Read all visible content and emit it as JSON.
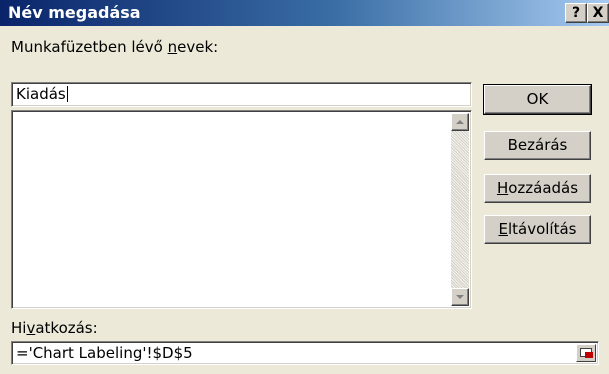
{
  "dialog": {
    "title": "Név megadása",
    "help_glyph": "?",
    "close_glyph": "X"
  },
  "names": {
    "label_pre": "Munkafüzetben lévő ",
    "label_u": "n",
    "label_post": "evek:",
    "value": "Kiadás",
    "list_items": []
  },
  "buttons": {
    "ok": "OK",
    "close": "Bezárás",
    "add_u": "H",
    "add_rest": "ozzáadás",
    "remove_u": "E",
    "remove_rest": "ltávolítás"
  },
  "reference": {
    "label_pre": "Hi",
    "label_u": "v",
    "label_post": "atkozás:",
    "value": "='Chart Labeling'!$D$5"
  },
  "colors": {
    "title_bar_start": "#0a246a",
    "title_bar_end": "#a6caf0",
    "face": "#ece9d8"
  },
  "icons": {
    "scroll_up": "triangle-up",
    "scroll_down": "triangle-down",
    "ref_collapse": "collapse-dialog-icon"
  }
}
